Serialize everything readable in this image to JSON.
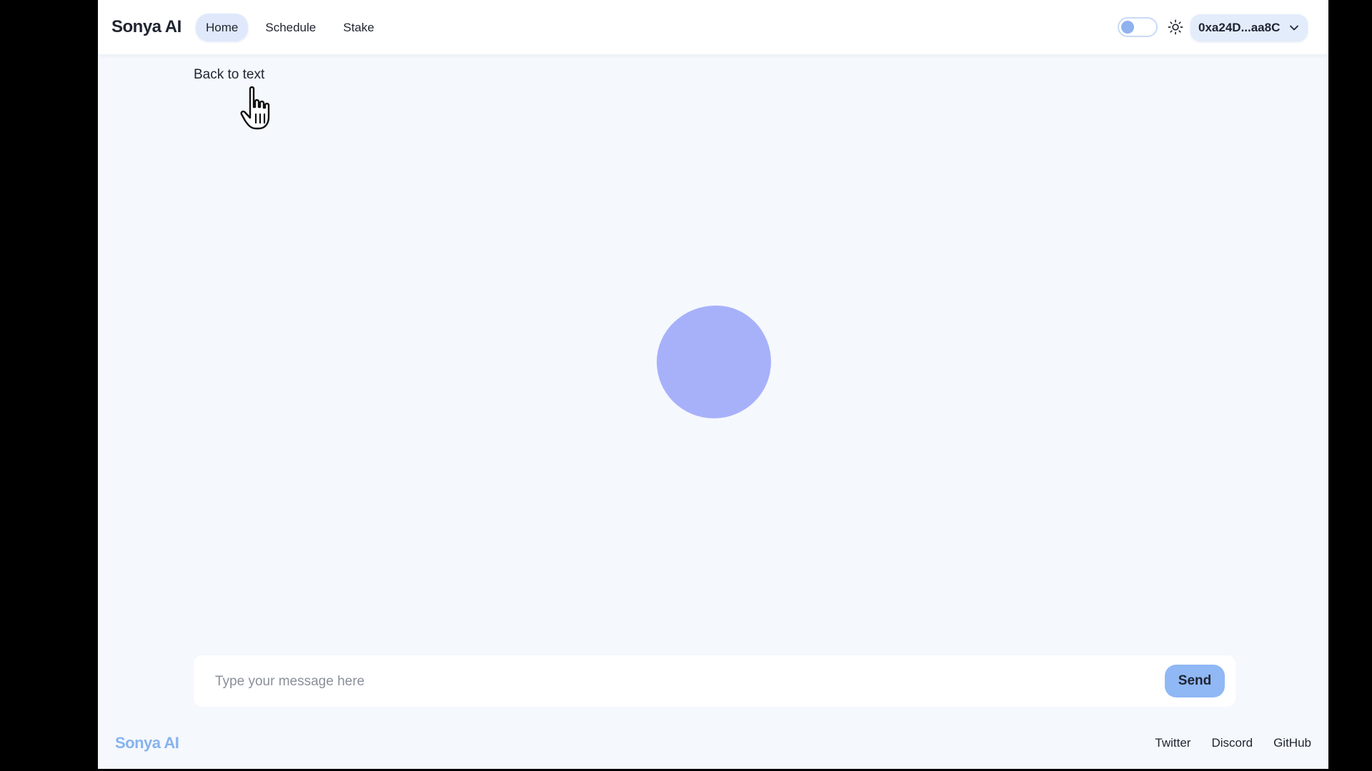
{
  "header": {
    "brand": "Sonya AI",
    "nav": [
      {
        "label": "Home",
        "active": true
      },
      {
        "label": "Schedule",
        "active": false
      },
      {
        "label": "Stake",
        "active": false
      }
    ],
    "theme_toggle_icon": "sun-icon",
    "wallet_address": "0xa24D...aa8C",
    "wallet_chevron_icon": "chevron-down-icon"
  },
  "main": {
    "back_link": "Back to text",
    "voice_blob_color": "#a7b1fa"
  },
  "composer": {
    "placeholder": "Type your message here",
    "value": "",
    "send_label": "Send"
  },
  "footer": {
    "brand": "Sonya AI",
    "links": [
      "Twitter",
      "Discord",
      "GitHub"
    ]
  },
  "colors": {
    "accent": "#8fb8f5",
    "background": "#f5f8fd"
  }
}
